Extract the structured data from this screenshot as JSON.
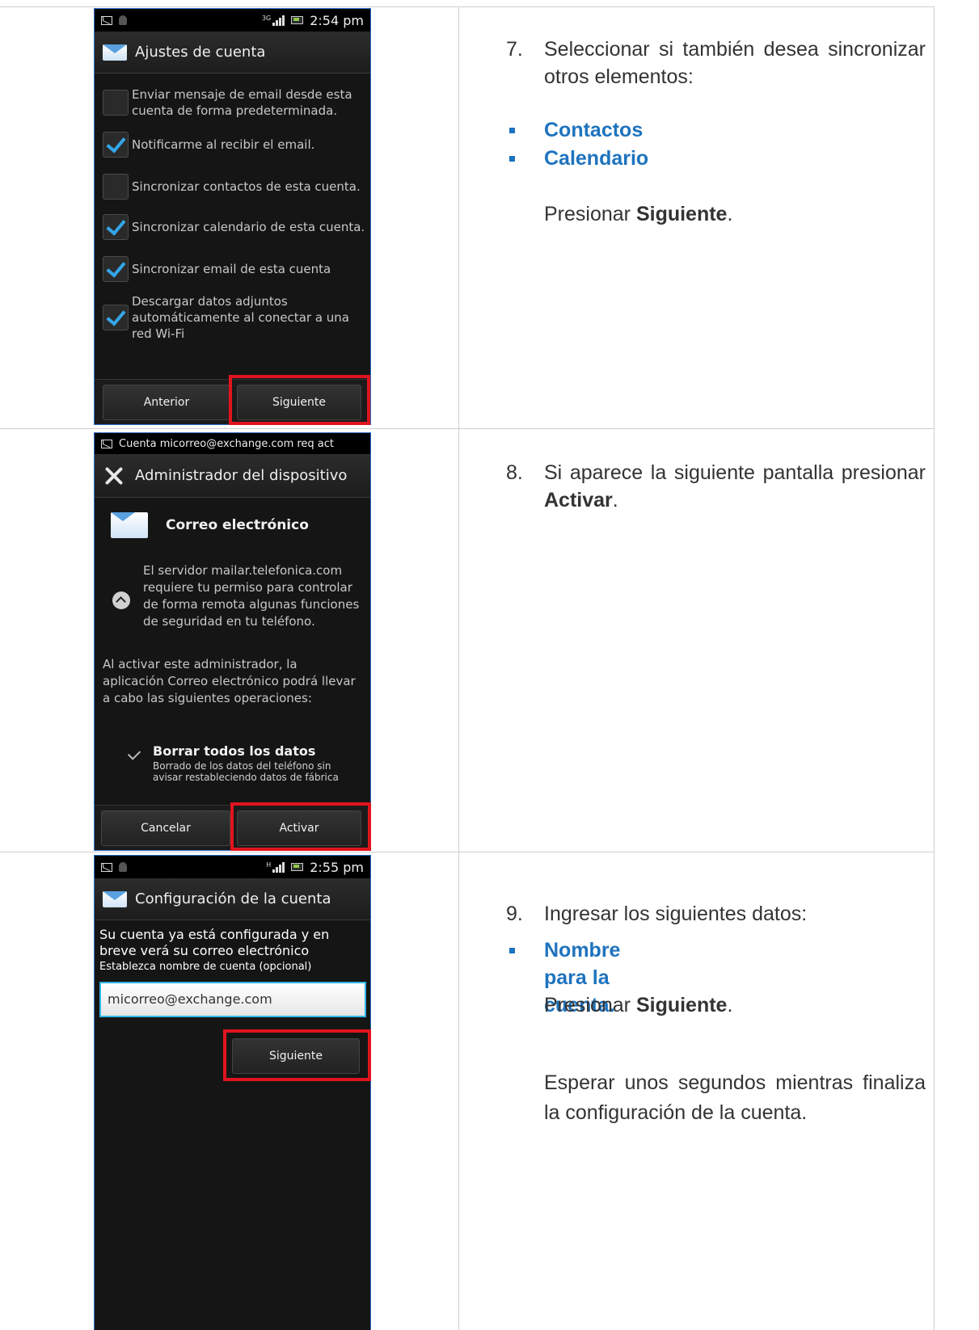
{
  "row1": {
    "phone": {
      "time": "2:54 pm",
      "network": "3G",
      "title": "Ajustes de cuenta",
      "options": [
        {
          "label": "Enviar mensaje de email desde esta cuenta de forma predeterminada.",
          "checked": false
        },
        {
          "label": "Notificarme al recibir el email.",
          "checked": true
        },
        {
          "label": "Sincronizar contactos de esta cuenta.",
          "checked": false
        },
        {
          "label": "Sincronizar calendario de esta cuenta.",
          "checked": true
        },
        {
          "label": "Sincronizar email de esta cuenta",
          "checked": true
        },
        {
          "label": "Descargar datos adjuntos automáticamente al conectar a una red Wi-Fi",
          "checked": true
        }
      ],
      "btn_prev": "Anterior",
      "btn_next": "Siguiente"
    },
    "step_number": "7.",
    "step_text": "Seleccionar si también desea sincronizar otros elementos:",
    "bullets": [
      "Contactos",
      "Calendario"
    ],
    "press_prefix": "Presionar ",
    "press_bold": "Siguiente",
    "press_suffix": "."
  },
  "row2": {
    "phone": {
      "notification": "Cuenta micorreo@exchange.com req act",
      "title": "Administrador del dispositivo",
      "app_name": "Correo electrónico",
      "permission_text": "El servidor mailar.telefonica.com requiere tu permiso para controlar de forma remota algunas funciones de seguridad en tu teléfono.",
      "admin_text": "Al activar este administrador, la aplicación Correo electrónico podrá llevar a cabo las siguientes operaciones:",
      "operation_title": "Borrar todos los datos",
      "operation_desc": "Borrado de los datos del teléfono sin avisar restableciendo datos de fábrica",
      "btn_cancel": "Cancelar",
      "btn_activate": "Activar"
    },
    "step_number": "8.",
    "step_text": "Si aparece la siguiente pantalla presionar",
    "step_bold": "Activar",
    "step_suffix": "."
  },
  "row3": {
    "phone": {
      "time": "2:55 pm",
      "network": "H",
      "title": "Configuración de la cuenta",
      "message": "Su cuenta ya está configurada y en breve verá su correo electrónico",
      "field_label": "Establezca nombre de cuenta (opcional)",
      "field_value": "micorreo@exchange.com",
      "btn_next": "Siguiente"
    },
    "step_number": "9.",
    "step_text": "Ingresar los siguientes datos:",
    "bullets": [
      "Nombre para la cuenta."
    ],
    "press_prefix": "Presionar ",
    "press_bold": "Siguiente",
    "press_suffix": ".",
    "wait_text": "Esperar unos segundos mientras finaliza la configuración de la cuenta."
  }
}
